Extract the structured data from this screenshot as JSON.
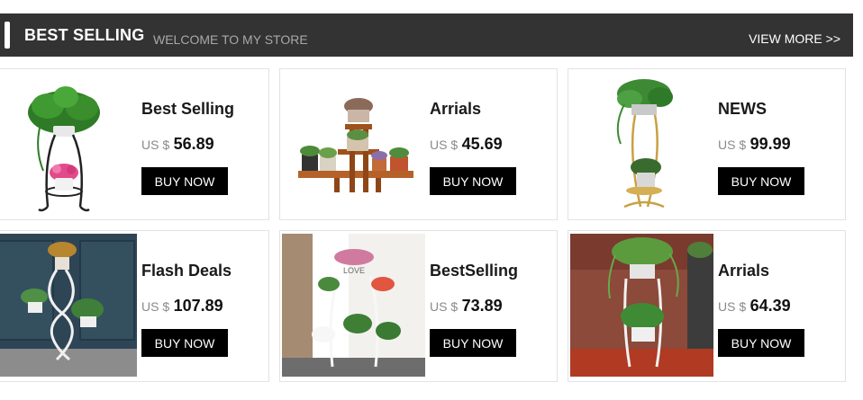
{
  "header": {
    "title": "BEST SELLING",
    "subtitle": "WELCOME TO MY STORE",
    "view_more": "VIEW MORE >>"
  },
  "products": [
    {
      "name": "Best Selling",
      "currency": "US $",
      "price": "56.89",
      "button": "BUY NOW",
      "image_icon": "metal-plant-stand-icon"
    },
    {
      "name": "Arrials",
      "currency": "US $",
      "price": "45.69",
      "button": "BUY NOW",
      "image_icon": "wooden-plant-stand-icon"
    },
    {
      "name": "NEWS",
      "currency": "US $",
      "price": "99.99",
      "button": "BUY NOW",
      "image_icon": "gold-plant-stand-icon"
    },
    {
      "name": "Flash Deals",
      "currency": "US $",
      "price": "107.89",
      "button": "BUY NOW",
      "image_icon": "scroll-plant-stand-icon"
    },
    {
      "name": "BestSelling",
      "currency": "US $",
      "price": "73.89",
      "button": "BUY NOW",
      "image_icon": "white-plant-stand-icon",
      "image_lettering": "LOVE"
    },
    {
      "name": "Arrials",
      "currency": "US $",
      "price": "64.39",
      "button": "BUY NOW",
      "image_icon": "tiered-plant-stand-icon"
    }
  ],
  "colors": {
    "header_bg": "#333333",
    "button_bg": "#000000",
    "card_border": "#e3e3e3",
    "muted_text": "#8a8a8a"
  }
}
